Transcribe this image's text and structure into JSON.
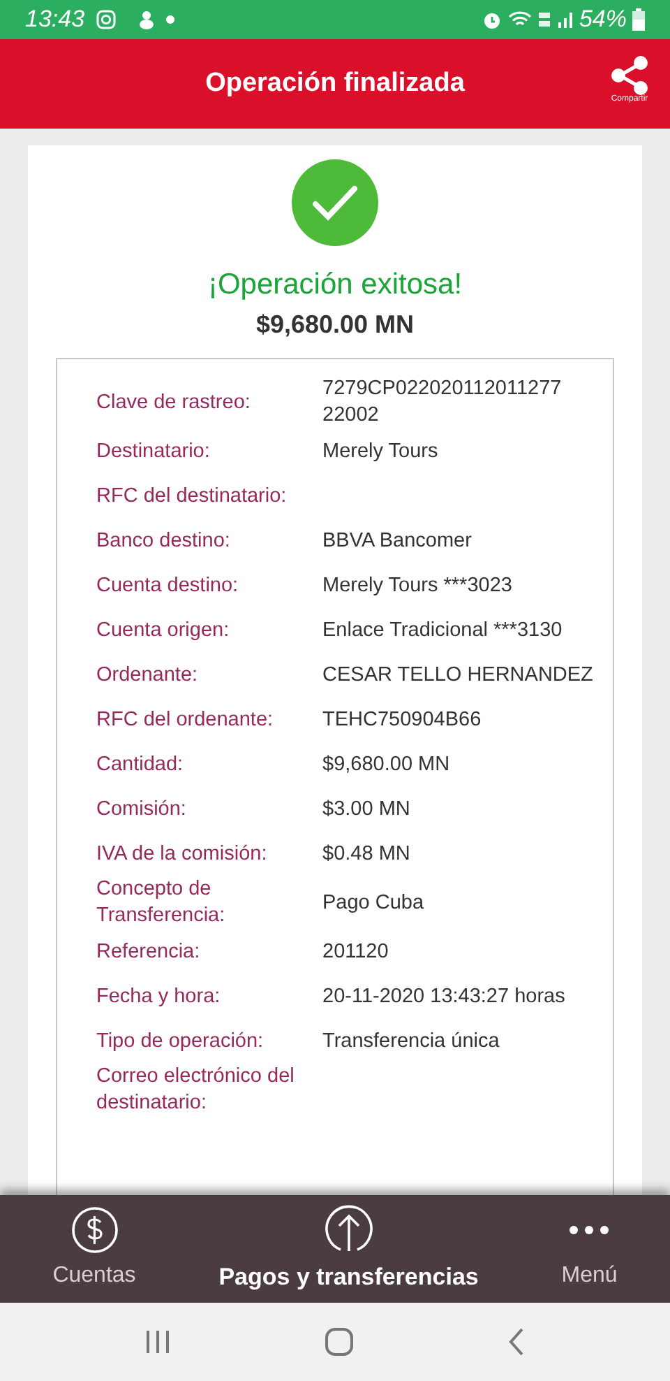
{
  "status_bar": {
    "time": "13:43",
    "battery": "54%"
  },
  "header": {
    "title": "Operación finalizada",
    "share_label": "Compartir"
  },
  "result": {
    "title": "¡Operación exitosa!",
    "amount": "$9,680.00 MN"
  },
  "details": [
    {
      "label": "Clave de rastreo:",
      "value": "7279CP022020112011277 22002"
    },
    {
      "label": "Destinatario:",
      "value": "Merely Tours"
    },
    {
      "label": "RFC del destinatario:"
    },
    {
      "label": "Banco destino:",
      "value": "BBVA Bancomer"
    },
    {
      "label": "Cuenta destino:",
      "value": "Merely Tours ***3023"
    },
    {
      "label": "Cuenta origen:",
      "value": "Enlace Tradicional ***3130"
    },
    {
      "label": "Ordenante:",
      "value": "CESAR TELLO HERNANDEZ"
    },
    {
      "label": "RFC del ordenante:",
      "value": "TEHC750904B66"
    },
    {
      "label": "Cantidad:",
      "value": "$9,680.00 MN"
    },
    {
      "label": "Comisión:",
      "value": "$3.00 MN"
    },
    {
      "label": "IVA de la comisión:",
      "value": "$0.48 MN"
    },
    {
      "label": "Concepto de Transferencia:",
      "value": "Pago Cuba"
    },
    {
      "label": "Referencia:",
      "value": "201120"
    },
    {
      "label": "Fecha y hora:",
      "value": "20-11-2020 13:43:27 horas"
    },
    {
      "label": "Tipo de operación:",
      "value": "Transferencia única"
    },
    {
      "label": "Correo electrónico del destinatario:"
    }
  ],
  "bottom_nav": [
    {
      "kind": "dollar",
      "label": "Cuentas",
      "selected": false
    },
    {
      "kind": "upload",
      "label": "Pagos y transferencias",
      "selected": true
    },
    {
      "kind": "dots",
      "label": "Menú",
      "selected": false
    }
  ]
}
